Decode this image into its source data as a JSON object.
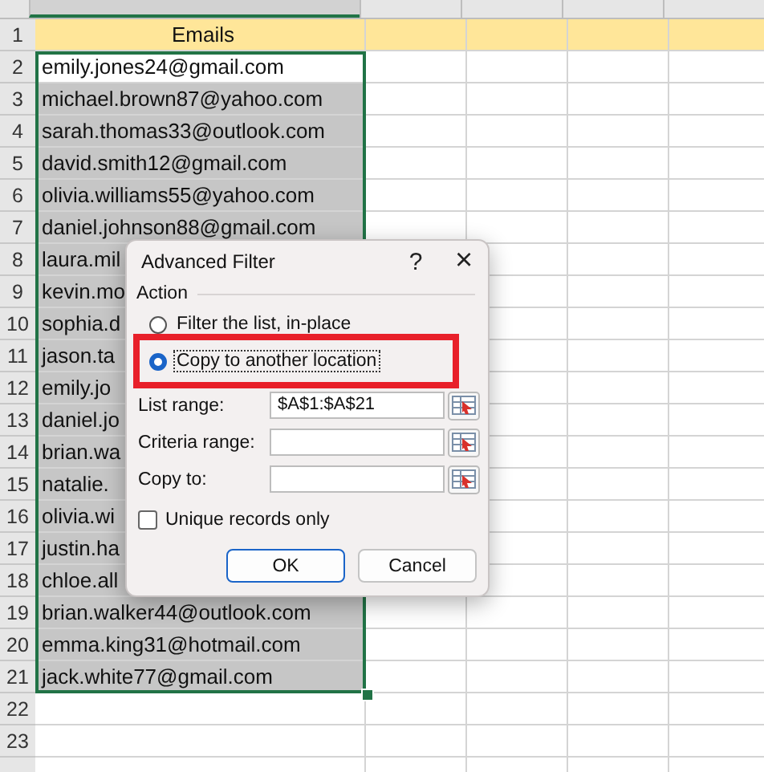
{
  "header": {
    "row": "1",
    "text": "Emails"
  },
  "rows": [
    {
      "row": "2",
      "email": "emily.jones24@gmail.com",
      "selected": false
    },
    {
      "row": "3",
      "email": "michael.brown87@yahoo.com",
      "selected": true
    },
    {
      "row": "4",
      "email": "sarah.thomas33@outlook.com",
      "selected": true
    },
    {
      "row": "5",
      "email": "david.smith12@gmail.com",
      "selected": true
    },
    {
      "row": "6",
      "email": "olivia.williams55@yahoo.com",
      "selected": true
    },
    {
      "row": "7",
      "email": "daniel.johnson88@gmail.com",
      "selected": true
    },
    {
      "row": "8",
      "email": "laura.mil",
      "selected": true
    },
    {
      "row": "9",
      "email": "kevin.mo",
      "selected": true
    },
    {
      "row": "10",
      "email": "sophia.d",
      "selected": true
    },
    {
      "row": "11",
      "email": "jason.ta",
      "selected": true
    },
    {
      "row": "12",
      "email": "emily.jo",
      "selected": true
    },
    {
      "row": "13",
      "email": "daniel.jo",
      "selected": true
    },
    {
      "row": "14",
      "email": "brian.wa",
      "selected": true
    },
    {
      "row": "15",
      "email": "natalie.",
      "selected": true
    },
    {
      "row": "16",
      "email": "olivia.wi",
      "selected": true
    },
    {
      "row": "17",
      "email": "justin.ha",
      "selected": true
    },
    {
      "row": "18",
      "email": "chloe.all",
      "selected": true
    },
    {
      "row": "19",
      "email": "brian.walker44@outlook.com",
      "selected": true
    },
    {
      "row": "20",
      "email": "emma.king31@hotmail.com",
      "selected": true
    },
    {
      "row": "21",
      "email": "jack.white77@gmail.com",
      "selected": true
    }
  ],
  "empty_rows": [
    "22",
    "23"
  ],
  "dialog": {
    "title": "Advanced Filter",
    "help": "?",
    "close": "×",
    "action_label": "Action",
    "options": [
      {
        "label": "Filter the list, in-place",
        "selected": false
      },
      {
        "label": "Copy to another location",
        "selected": true
      }
    ],
    "fields": [
      {
        "label": "List range:",
        "value": "$A$1:$A$21"
      },
      {
        "label": "Criteria range:"
      },
      {
        "label": "Copy to:"
      }
    ],
    "unique": {
      "label": "Unique records only",
      "checked": false
    },
    "buttons": [
      {
        "label": "OK",
        "default": true
      },
      {
        "label": "Cancel",
        "default": false
      }
    ]
  }
}
